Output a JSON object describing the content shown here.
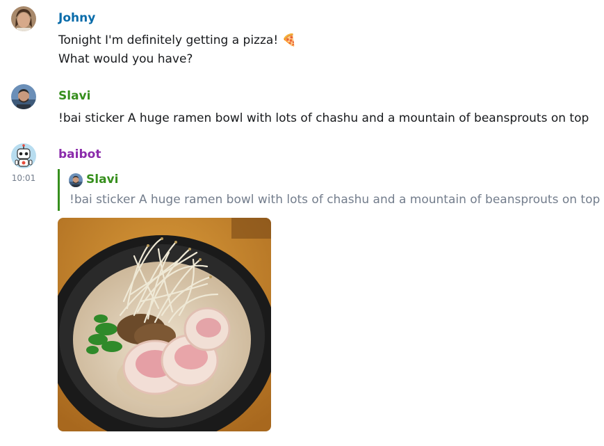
{
  "messages": [
    {
      "sender": "Johny",
      "sender_color": "#0a6caa",
      "lines": [
        "Tonight I'm definitely getting a pizza! 🍕",
        "What would you have?"
      ]
    },
    {
      "sender": "Slavi",
      "sender_color": "#368f1d",
      "lines": [
        "!bai sticker A huge ramen bowl with lots of chashu and a mountain of beansprouts on top"
      ]
    },
    {
      "sender": "baibot",
      "sender_color": "#8b2bab",
      "timestamp": "10:01",
      "reply": {
        "sender": "Slavi",
        "text": "!bai sticker A huge ramen bowl with lots of chashu and a mountain of beansprouts on top"
      },
      "sticker_icon": "ramen-bowl-image"
    }
  ]
}
